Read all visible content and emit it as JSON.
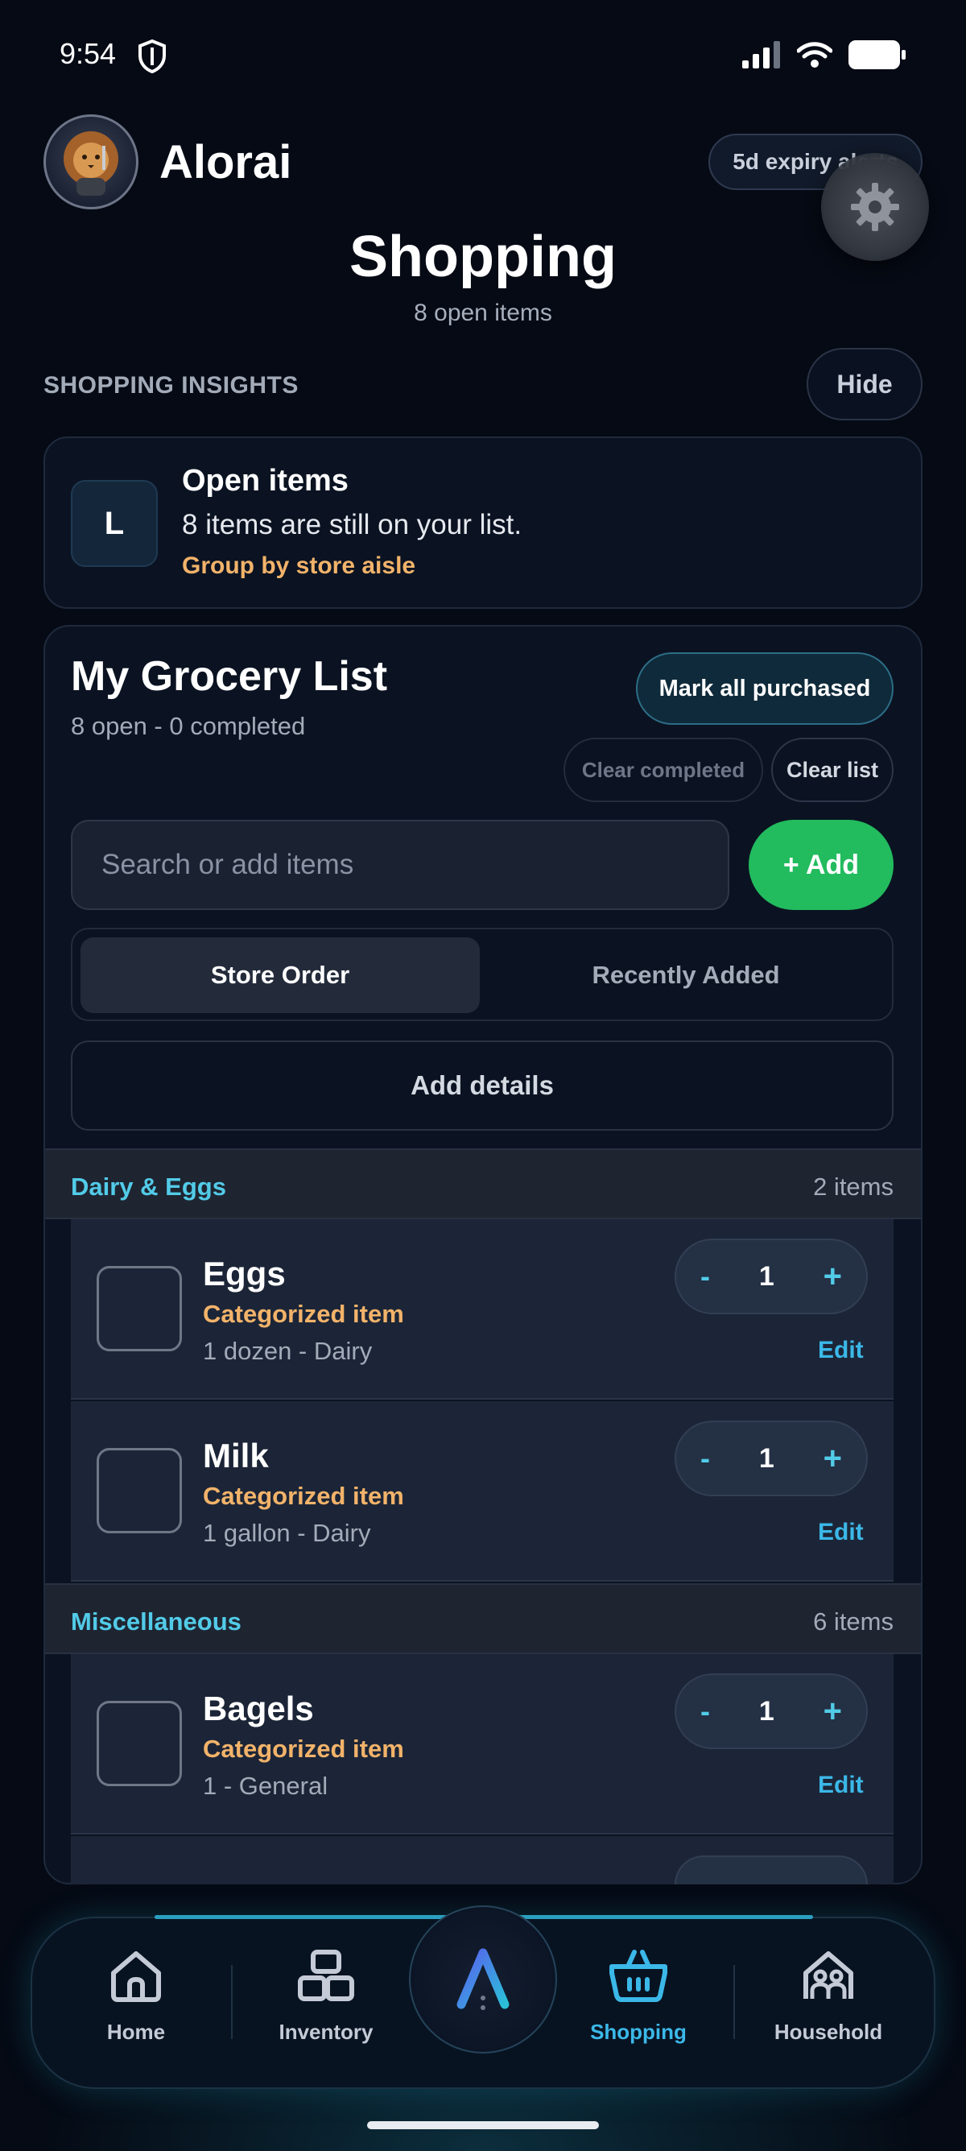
{
  "status_bar": {
    "time": "9:54"
  },
  "header": {
    "username": "Alorai",
    "expiry_alerts": "5d expiry alerts",
    "title": "Shopping",
    "subtitle": "8 open items"
  },
  "insights": {
    "section_label": "SHOPPING INSIGHTS",
    "hide_label": "Hide",
    "card": {
      "badge": "L",
      "title": "Open items",
      "text": "8 items are still on your list.",
      "link": "Group by store aisle"
    }
  },
  "list": {
    "title": "My Grocery List",
    "summary": "8 open - 0 completed",
    "mark_all": "Mark all purchased",
    "clear_completed": "Clear completed",
    "clear_list": "Clear list",
    "search_placeholder": "Search or add items",
    "add_label": "+ Add",
    "sort_options": [
      "Store Order",
      "Recently Added"
    ],
    "active_sort": "Store Order",
    "add_details": "Add details",
    "sections": [
      {
        "name": "Dairy & Eggs",
        "count": "2 items",
        "items": [
          {
            "name": "Eggs",
            "category": "Categorized item",
            "meta": "1 dozen - Dairy",
            "qty": "1",
            "minus": "-",
            "plus": "+",
            "edit": "Edit"
          },
          {
            "name": "Milk",
            "category": "Categorized item",
            "meta": "1 gallon - Dairy",
            "qty": "1",
            "minus": "-",
            "plus": "+",
            "edit": "Edit"
          }
        ]
      },
      {
        "name": "Miscellaneous",
        "count": "6 items",
        "items": [
          {
            "name": "Bagels",
            "category": "Categorized item",
            "meta": "1 - General",
            "qty": "1",
            "minus": "-",
            "plus": "+",
            "edit": "Edit"
          }
        ]
      }
    ]
  },
  "nav": {
    "items": [
      {
        "label": "Home",
        "icon": "home-icon"
      },
      {
        "label": "Inventory",
        "icon": "inventory-icon"
      },
      {
        "label": "Shopping",
        "icon": "shopping-basket-icon",
        "active": true
      },
      {
        "label": "Household",
        "icon": "household-icon"
      }
    ],
    "center_icon": "app-logo-icon"
  },
  "colors": {
    "background": "#050a14",
    "accent": "#3bb8e8",
    "add_green": "#22bb5e",
    "category_orange": "#f2b36a",
    "section_cyan": "#52cbe8"
  }
}
